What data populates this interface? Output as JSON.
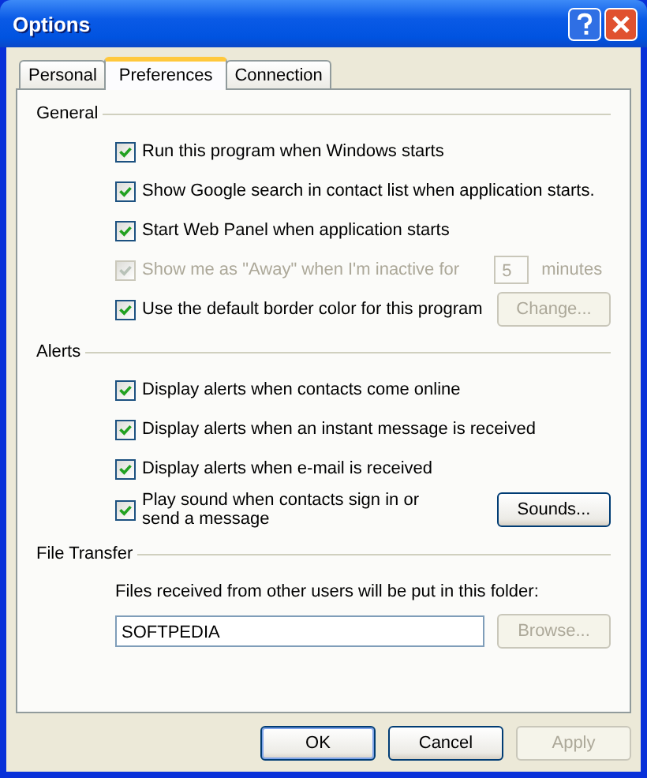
{
  "window": {
    "title": "Options"
  },
  "tabs": [
    {
      "label": "Personal",
      "selected": false
    },
    {
      "label": "Preferences",
      "selected": true
    },
    {
      "label": "Connection",
      "selected": false
    }
  ],
  "sections": [
    {
      "title": "General",
      "items": [
        {
          "kind": "checkbox",
          "label": "Run this program when Windows starts",
          "checked": true,
          "disabled": false
        },
        {
          "kind": "checkbox",
          "label": "Show Google search in contact list when application starts.",
          "checked": true,
          "disabled": false
        },
        {
          "kind": "checkbox",
          "label": "Start Web Panel when application starts",
          "checked": true,
          "disabled": false
        },
        {
          "kind": "checkbox_number",
          "label": "Show me as \"Away\" when I'm inactive for",
          "checked": true,
          "disabled": true,
          "value": "5",
          "unit": "minutes"
        },
        {
          "kind": "checkbox_button",
          "label": "Use the default border color for this program",
          "checked": true,
          "disabled": false,
          "button": {
            "label": "Change...",
            "disabled": true
          }
        }
      ]
    },
    {
      "title": "Alerts",
      "items": [
        {
          "kind": "checkbox",
          "label": "Display alerts when contacts come online",
          "checked": true,
          "disabled": false
        },
        {
          "kind": "checkbox",
          "label": "Display alerts when an instant message is received",
          "checked": true,
          "disabled": false
        },
        {
          "kind": "checkbox",
          "label": "Display alerts when e-mail is received",
          "checked": true,
          "disabled": false
        },
        {
          "kind": "checkbox_button",
          "label": "Play sound when contacts sign in or send a message",
          "checked": true,
          "disabled": false,
          "button": {
            "label": "Sounds...",
            "disabled": false
          }
        }
      ]
    },
    {
      "title": "File Transfer",
      "items": [
        {
          "kind": "text",
          "label": "Files received from other users will be put in this folder:"
        },
        {
          "kind": "folder",
          "value": "SOFTPEDIA",
          "button": {
            "label": "Browse...",
            "disabled": true
          }
        }
      ]
    }
  ],
  "buttons": [
    {
      "label": "OK",
      "default": true,
      "disabled": false
    },
    {
      "label": "Cancel",
      "default": false,
      "disabled": false
    },
    {
      "label": "Apply",
      "default": false,
      "disabled": true
    }
  ]
}
